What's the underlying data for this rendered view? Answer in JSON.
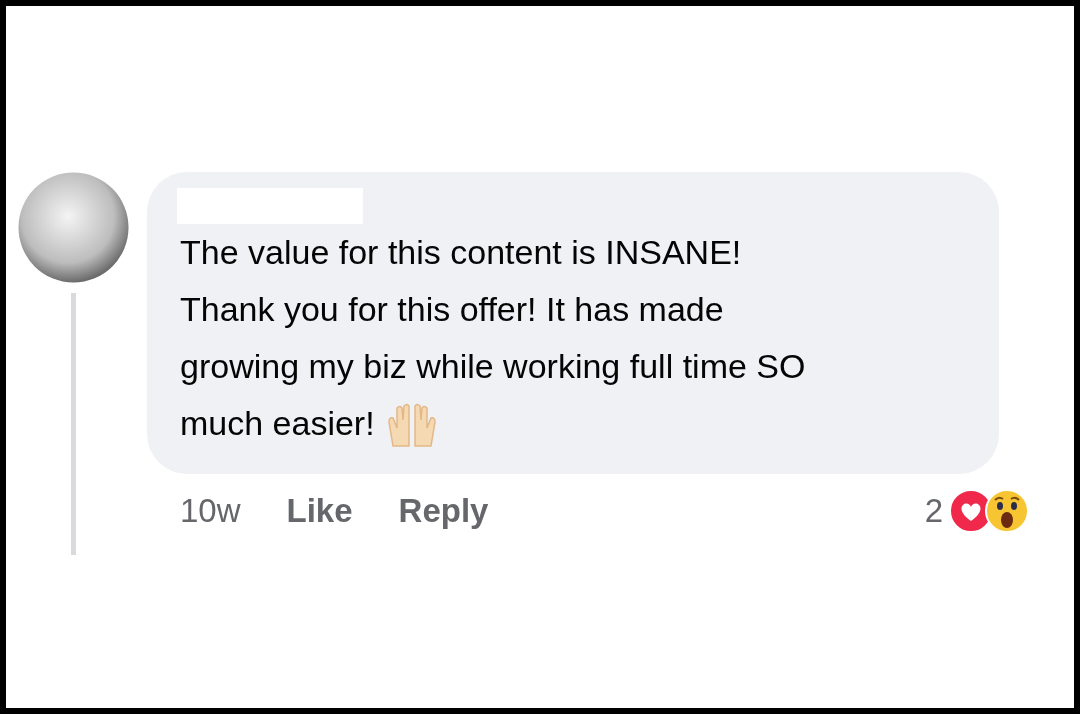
{
  "comment": {
    "message_lines": [
      "The value for this content is INSANE!",
      "Thank you for this offer! It has made",
      "growing my biz while working full time SO",
      "much easier!"
    ],
    "time": "10w",
    "actions": [
      "Like",
      "Reply"
    ],
    "reaction_count": "2",
    "reactions": [
      {
        "kind": "love"
      },
      {
        "kind": "wow"
      }
    ]
  }
}
